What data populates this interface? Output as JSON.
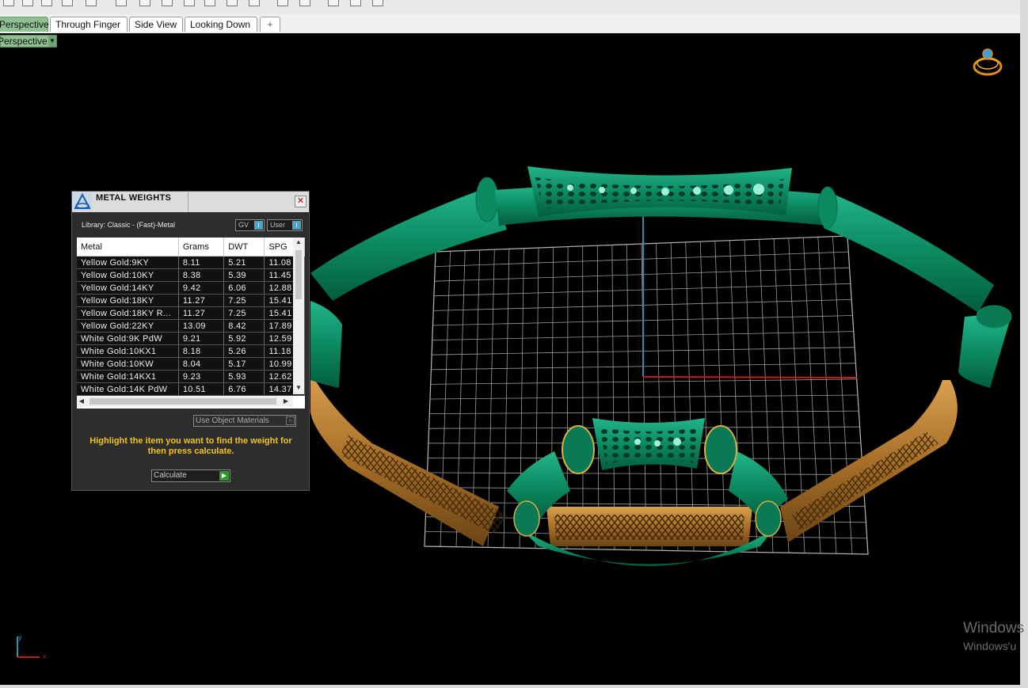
{
  "tabs": [
    {
      "label": "Perspective",
      "active": true
    },
    {
      "label": "Through Finger",
      "active": false
    },
    {
      "label": "Side View",
      "active": false
    },
    {
      "label": "Looking Down",
      "active": false
    }
  ],
  "add_tab_glyph": "+",
  "viewport_label": "Perspective",
  "viewport_menu_glyph": "▼",
  "axis_labels": {
    "x": "x",
    "y": "y"
  },
  "panel": {
    "title": "METAL WEIGHTS",
    "close_glyph": "✕",
    "library": "Library: Classic - (Fast)-Metal",
    "toggle_gv": "GV",
    "toggle_user": "User",
    "toggle_glyph": "i",
    "columns": [
      "Metal",
      "Grams",
      "DWT",
      "SPG"
    ],
    "rows": [
      [
        "Yellow Gold:9KY",
        "8.11",
        "5.21",
        "11.08"
      ],
      [
        "Yellow Gold:10KY",
        "8.38",
        "5.39",
        "11.45"
      ],
      [
        "Yellow Gold:14KY",
        "9.42",
        "6.06",
        "12.88"
      ],
      [
        "Yellow Gold:18KY",
        "11.27",
        "7.25",
        "15.41"
      ],
      [
        "Yellow Gold:18KY R...",
        "11.27",
        "7.25",
        "15.41"
      ],
      [
        "Yellow Gold:22KY",
        "13.09",
        "8.42",
        "17.89"
      ],
      [
        "White Gold:9K PdW",
        "9.21",
        "5.92",
        "12.59"
      ],
      [
        "White Gold:10KX1",
        "8.18",
        "5.26",
        "11.18"
      ],
      [
        "White Gold:10KW",
        "8.04",
        "5.17",
        "10.99"
      ],
      [
        "White Gold:14KX1",
        "9.23",
        "5.93",
        "12.62"
      ],
      [
        "White Gold:14K PdW",
        "10.51",
        "6.76",
        "14.37"
      ]
    ],
    "scroll_up": "▲",
    "scroll_down": "▼",
    "scroll_left": "◀",
    "scroll_right": "▶",
    "use_object_materials": "Use Object Materials",
    "hint": "Highlight the item you want to find the weight for then press calculate.",
    "calculate_label": "Calculate",
    "calculate_glyph": "▶"
  },
  "watermark": {
    "line1": "Windows",
    "line2": "Windows'u"
  },
  "colors": {
    "tab_active": "#8fc08f",
    "model_green": "#0c8a62",
    "model_gold": "#b27a2e",
    "grid_line": "#b8b8b8",
    "axis_y": "#2a8fb0",
    "axis_x": "#c02020",
    "hint_text": "#f2c418"
  },
  "icons": [
    "ring-navigator-icon",
    "matrix-logo-icon",
    "close-icon",
    "calculate-arrow-icon",
    "info-toggle-icon"
  ]
}
